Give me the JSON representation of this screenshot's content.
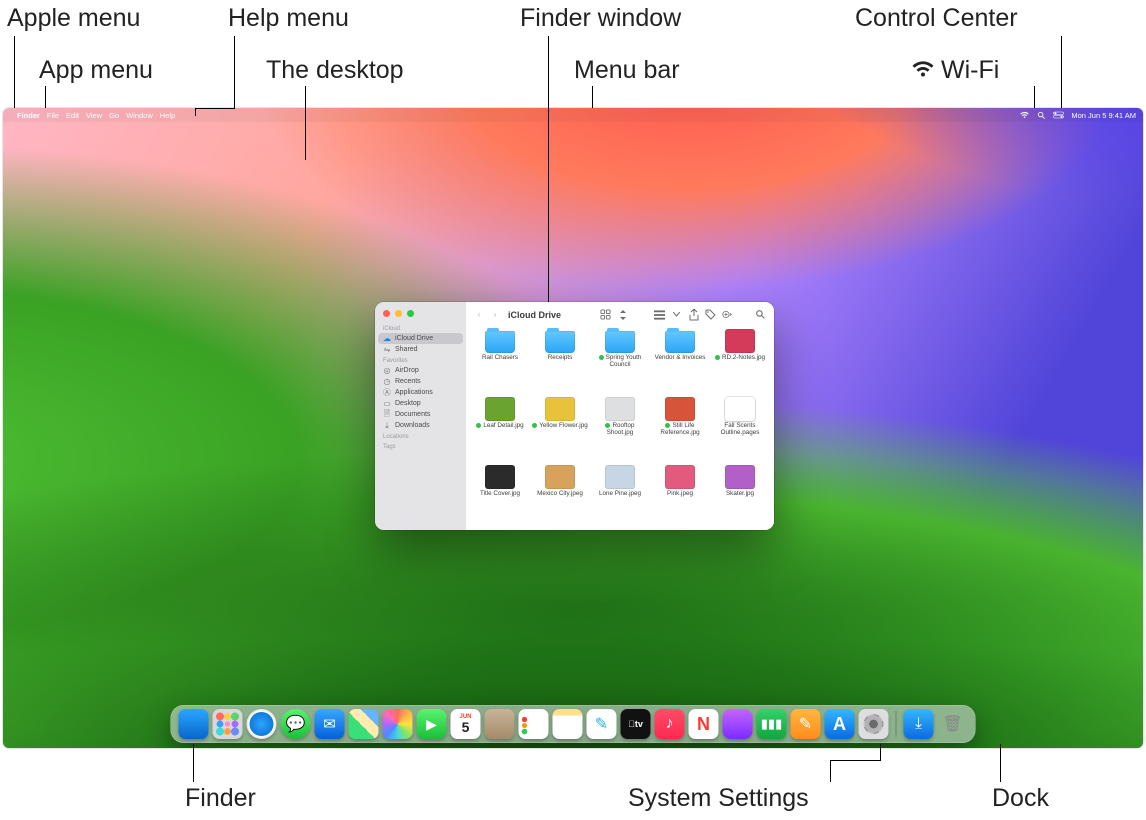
{
  "callouts": {
    "apple_menu": "Apple menu",
    "app_menu": "App menu",
    "help_menu": "Help menu",
    "desktop": "The desktop",
    "finder_window": "Finder window",
    "menu_bar": "Menu bar",
    "wifi": "Wi-Fi",
    "control_center": "Control Center",
    "finder": "Finder",
    "system_settings": "System Settings",
    "dock": "Dock"
  },
  "menubar": {
    "app": "Finder",
    "items": [
      "File",
      "Edit",
      "View",
      "Go",
      "Window",
      "Help"
    ],
    "clock": "Mon Jun 5  9:41 AM"
  },
  "finder": {
    "title": "iCloud Drive",
    "sidebar": {
      "sections": [
        {
          "header": "iCloud",
          "items": [
            {
              "label": "iCloud Drive",
              "icon": "icloud",
              "selected": true
            },
            {
              "label": "Shared",
              "icon": "shared"
            }
          ]
        },
        {
          "header": "Favorites",
          "items": [
            {
              "label": "AirDrop",
              "icon": "airdrop"
            },
            {
              "label": "Recents",
              "icon": "recents"
            },
            {
              "label": "Applications",
              "icon": "applications"
            },
            {
              "label": "Desktop",
              "icon": "desktop"
            },
            {
              "label": "Documents",
              "icon": "documents"
            },
            {
              "label": "Downloads",
              "icon": "downloads"
            }
          ]
        },
        {
          "header": "Locations",
          "items": []
        },
        {
          "header": "Tags",
          "items": []
        }
      ]
    },
    "files": [
      {
        "name": "Rail Chasers",
        "kind": "folder"
      },
      {
        "name": "Receipts",
        "kind": "folder"
      },
      {
        "name": "Spring Youth Council",
        "kind": "folder",
        "tag": "green"
      },
      {
        "name": "Vendor & Invoices",
        "kind": "folder"
      },
      {
        "name": "RD.2-Notes.jpg",
        "kind": "image",
        "tag": "green",
        "swatch": "#d43b5a"
      },
      {
        "name": "Leaf Detail.jpg",
        "kind": "image",
        "tag": "green",
        "swatch": "#6aa330"
      },
      {
        "name": "Yellow Flower.jpg",
        "kind": "image",
        "tag": "green",
        "swatch": "#e7c23a"
      },
      {
        "name": "Rooftop Shoot.jpg",
        "kind": "image",
        "tag": "green",
        "swatch": "#dedfe1"
      },
      {
        "name": "Still Life Reference.jpg",
        "kind": "image",
        "tag": "green",
        "swatch": "#d7543a"
      },
      {
        "name": "Fall Scents Outline.pages",
        "kind": "doc"
      },
      {
        "name": "Title Cover.jpg",
        "kind": "image",
        "swatch": "#2b2b2b"
      },
      {
        "name": "Mexico City.jpeg",
        "kind": "image",
        "swatch": "#d7a25c"
      },
      {
        "name": "Lone Pine.jpeg",
        "kind": "image",
        "swatch": "#c7d6e4"
      },
      {
        "name": "Pink.jpeg",
        "kind": "image",
        "swatch": "#e35a7f"
      },
      {
        "name": "Skater.jpg",
        "kind": "image",
        "swatch": "#b260c8"
      }
    ],
    "calendar_badge": {
      "mon": "JUN",
      "day": "5"
    }
  },
  "dock": {
    "apps": [
      {
        "name": "Finder",
        "cls": "di-finder"
      },
      {
        "name": "Launchpad",
        "cls": "di-launchpad"
      },
      {
        "name": "Safari",
        "cls": "di-safari"
      },
      {
        "name": "Messages",
        "cls": "di-messages"
      },
      {
        "name": "Mail",
        "cls": "di-mail"
      },
      {
        "name": "Maps",
        "cls": "di-maps"
      },
      {
        "name": "Photos",
        "cls": "di-photos"
      },
      {
        "name": "FaceTime",
        "cls": "di-facetime"
      },
      {
        "name": "Calendar",
        "cls": "di-calendar"
      },
      {
        "name": "Contacts",
        "cls": "di-contacts"
      },
      {
        "name": "Reminders",
        "cls": "di-reminders"
      },
      {
        "name": "Notes",
        "cls": "di-notes"
      },
      {
        "name": "Freeform",
        "cls": "di-freeform"
      },
      {
        "name": "TV",
        "cls": "di-tv"
      },
      {
        "name": "Music",
        "cls": "di-music"
      },
      {
        "name": "News",
        "cls": "di-news"
      },
      {
        "name": "Podcasts",
        "cls": "di-podcasts"
      },
      {
        "name": "Numbers",
        "cls": "di-numbers"
      },
      {
        "name": "Pages",
        "cls": "di-pages"
      },
      {
        "name": "App Store",
        "cls": "di-appstore"
      },
      {
        "name": "System Settings",
        "cls": "di-settings"
      }
    ],
    "right": [
      {
        "name": "Downloads",
        "cls": "di-downloads"
      },
      {
        "name": "Trash",
        "cls": "di-trash"
      }
    ]
  }
}
